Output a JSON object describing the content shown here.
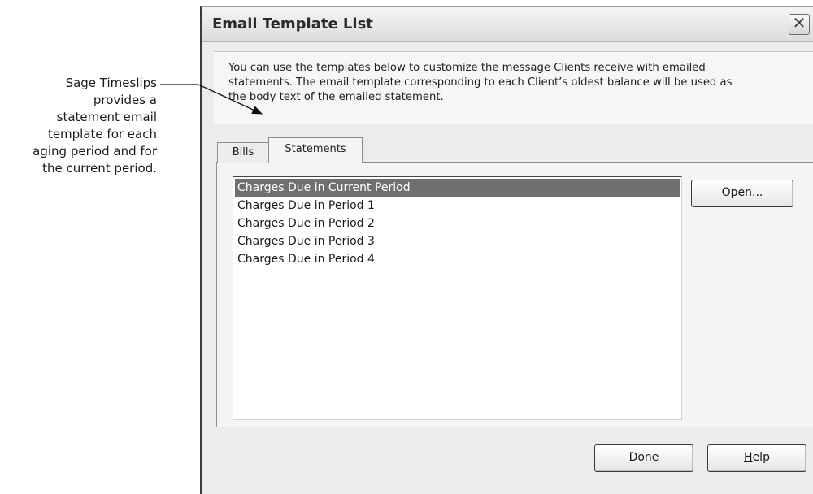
{
  "callout": {
    "lines": [
      "Sage Timeslips",
      "provides a",
      "statement email",
      "template for each",
      "aging period and for",
      "the current period."
    ]
  },
  "dialog": {
    "title": "Email Template List",
    "close_symbol": "✕",
    "info_lines": [
      "You can use the templates below to customize the message Clients receive with emailed",
      "statements. The email template corresponding to each Client’s oldest balance will be used as",
      "the body text of the emailed statement."
    ],
    "tabs": [
      "Bills",
      "Statements"
    ],
    "active_tab": "Statements",
    "templates": [
      "Charges Due in Current Period",
      "Charges Due in Period 1",
      "Charges Due in Period 2",
      "Charges Due in Period 3",
      "Charges Due in Period 4"
    ],
    "selected_template": "Charges Due in Current Period",
    "buttons": {
      "open": {
        "accel": "O",
        "rest": "pen..."
      },
      "done": "Done",
      "help": {
        "accel": "H",
        "rest": "elp"
      }
    }
  }
}
